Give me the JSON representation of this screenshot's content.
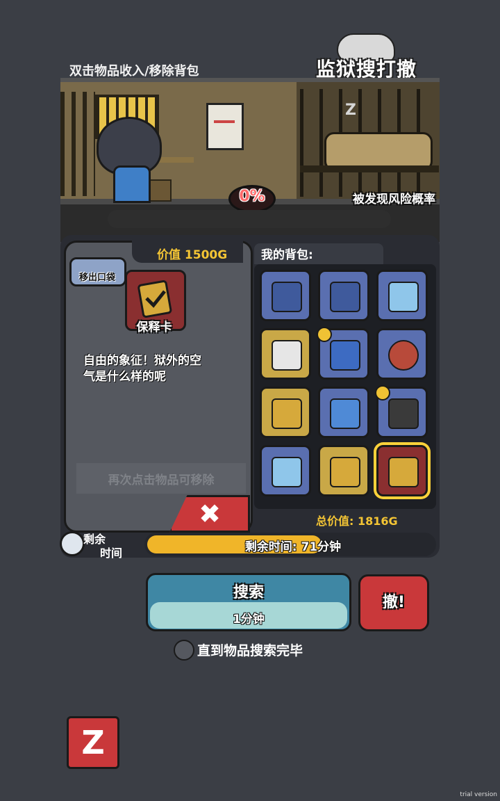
{
  "header": {
    "hint": "双击物品收入/移除背包",
    "game_title": "监狱搜打撤"
  },
  "scene": {
    "risk_percent": "0%",
    "risk_label": "被发现风险概率",
    "sleep_symbol": "Z"
  },
  "detail": {
    "value_label": "价值 1500G",
    "pocket_button": "移出口袋",
    "item_name": "保释卡",
    "description_line1": "自由的象征！狱外的空",
    "description_line2": "气是什么样的呢",
    "remove_hint": "再次点击物品可移除",
    "close_symbol": "✖"
  },
  "bag": {
    "title": "我的背包:",
    "total_value": "总价值: 1816G",
    "slots": [
      {
        "name": "food-bag",
        "color": "blue"
      },
      {
        "name": "food-bag",
        "color": "blue"
      },
      {
        "name": "glasses-card",
        "color": "blue"
      },
      {
        "name": "portrait-pack",
        "color": "gold"
      },
      {
        "name": "lightning-card",
        "color": "blue",
        "coin": true
      },
      {
        "name": "meat-pie",
        "color": "blue"
      },
      {
        "name": "infinity-card",
        "color": "gold"
      },
      {
        "name": "ticket",
        "color": "blue"
      },
      {
        "name": "usb-drive",
        "color": "blue",
        "coin": true
      },
      {
        "name": "glasses-card",
        "color": "blue"
      },
      {
        "name": "infinity-card",
        "color": "gold"
      },
      {
        "name": "bail-card",
        "color": "red",
        "selected": true
      }
    ]
  },
  "timer": {
    "label_line1": "剩余",
    "label_line2": "时间",
    "text": "剩余时间: 71分钟",
    "progress_fraction": 0.61
  },
  "actions": {
    "search_label": "搜索",
    "search_duration": "1分钟",
    "escape_label": "撤!",
    "until_done_label": "直到物品搜索完毕",
    "z_label": "Z"
  },
  "watermark": "trial version",
  "colors": {
    "background": "#3b3e45",
    "accent_gold": "#f4c534",
    "danger_red": "#c9383a",
    "search_blue": "#3f87a4"
  }
}
